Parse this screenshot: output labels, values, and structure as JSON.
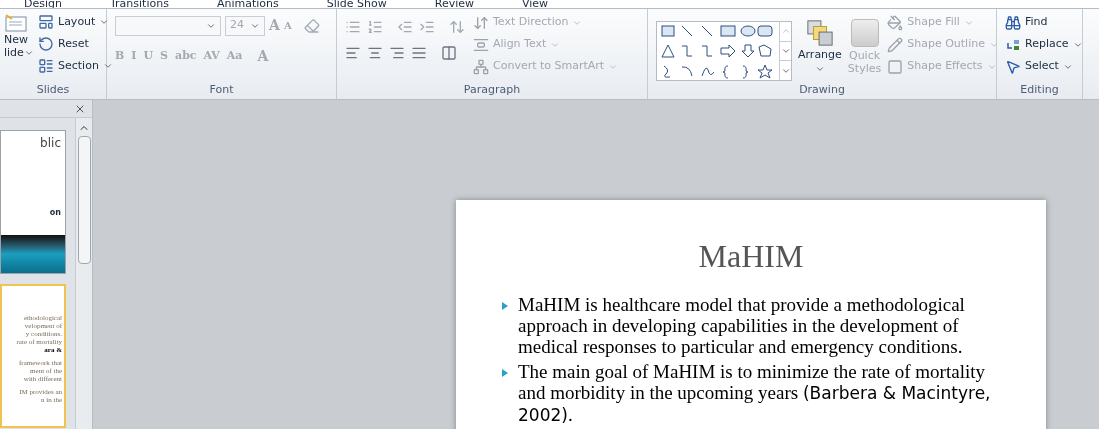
{
  "ribbon_tabs": [
    {
      "label": "Design",
      "selected": false
    },
    {
      "label": "Transitions",
      "selected": false
    },
    {
      "label": "Animations",
      "selected": false
    },
    {
      "label": "Slide Show",
      "selected": false
    },
    {
      "label": "Review",
      "selected": false
    },
    {
      "label": "View",
      "selected": false
    }
  ],
  "slides_group": {
    "label": "Slides",
    "new_slide": [
      "New",
      "lide"
    ],
    "commands": [
      {
        "label": "Layout",
        "kind": "layout",
        "dropdown": true
      },
      {
        "label": "Reset",
        "kind": "reset",
        "dropdown": false
      },
      {
        "label": "Section",
        "kind": "section",
        "dropdown": true
      }
    ]
  },
  "font_group": {
    "label": "Font",
    "font_size": "24",
    "disabled": true,
    "buttons": [
      "B",
      "I",
      "U",
      "S",
      "abc",
      "AV",
      "Aa"
    ],
    "grow": "A",
    "shrink": "A",
    "font_color_label": "A"
  },
  "paragraph_group": {
    "label": "Paragraph",
    "disabled": true,
    "commands": [
      {
        "label": "Text Direction",
        "kind": "direction"
      },
      {
        "label": "Align Text",
        "kind": "align"
      },
      {
        "label": "Convert to SmartArt",
        "kind": "smartart"
      }
    ]
  },
  "drawing_group": {
    "label": "Drawing",
    "arrange": "Arrange",
    "quick_styles": [
      "Quick",
      "Styles"
    ],
    "quick_styles_disabled": true,
    "commands": [
      {
        "label": "Shape Fill",
        "kind": "fill",
        "disabled": true
      },
      {
        "label": "Shape Outline",
        "kind": "outline",
        "disabled": true
      },
      {
        "label": "Shape Effects",
        "kind": "effects",
        "disabled": true
      }
    ]
  },
  "editing_group": {
    "label": "Editing",
    "commands": [
      {
        "label": "Find",
        "kind": "find",
        "dropdown": false
      },
      {
        "label": "Replace",
        "kind": "replace",
        "dropdown": true
      },
      {
        "label": "Select",
        "kind": "select",
        "dropdown": true
      }
    ]
  },
  "thumbnails": [
    {
      "selected": false,
      "lines": [
        "blic",
        "on"
      ],
      "kind": "title"
    },
    {
      "selected": true,
      "lines": [
        "ethodological",
        "velopment of",
        "y conditions.",
        "rate of mortality",
        "ara &",
        "framework that",
        "ment of the",
        "with different",
        "IM provides an",
        "n in the"
      ],
      "kind": "text"
    }
  ],
  "slide": {
    "title": "MaHIM",
    "bullets": [
      {
        "parts": [
          {
            "text": "MaHIM is healthcare model that provide a methodological approach in developing capabilities in the development of medical responses to particular and emergency conditions.",
            "kind": "serif"
          }
        ]
      },
      {
        "parts": [
          {
            "text": "The main goal of MaHIM is to minimize the rate of mortality and morbidity  in the upcoming years ",
            "kind": "serif"
          },
          {
            "text": "(Barbera & Macintyre, 2002)",
            "kind": "sans"
          },
          {
            "text": ".",
            "kind": "serif"
          }
        ]
      }
    ]
  }
}
